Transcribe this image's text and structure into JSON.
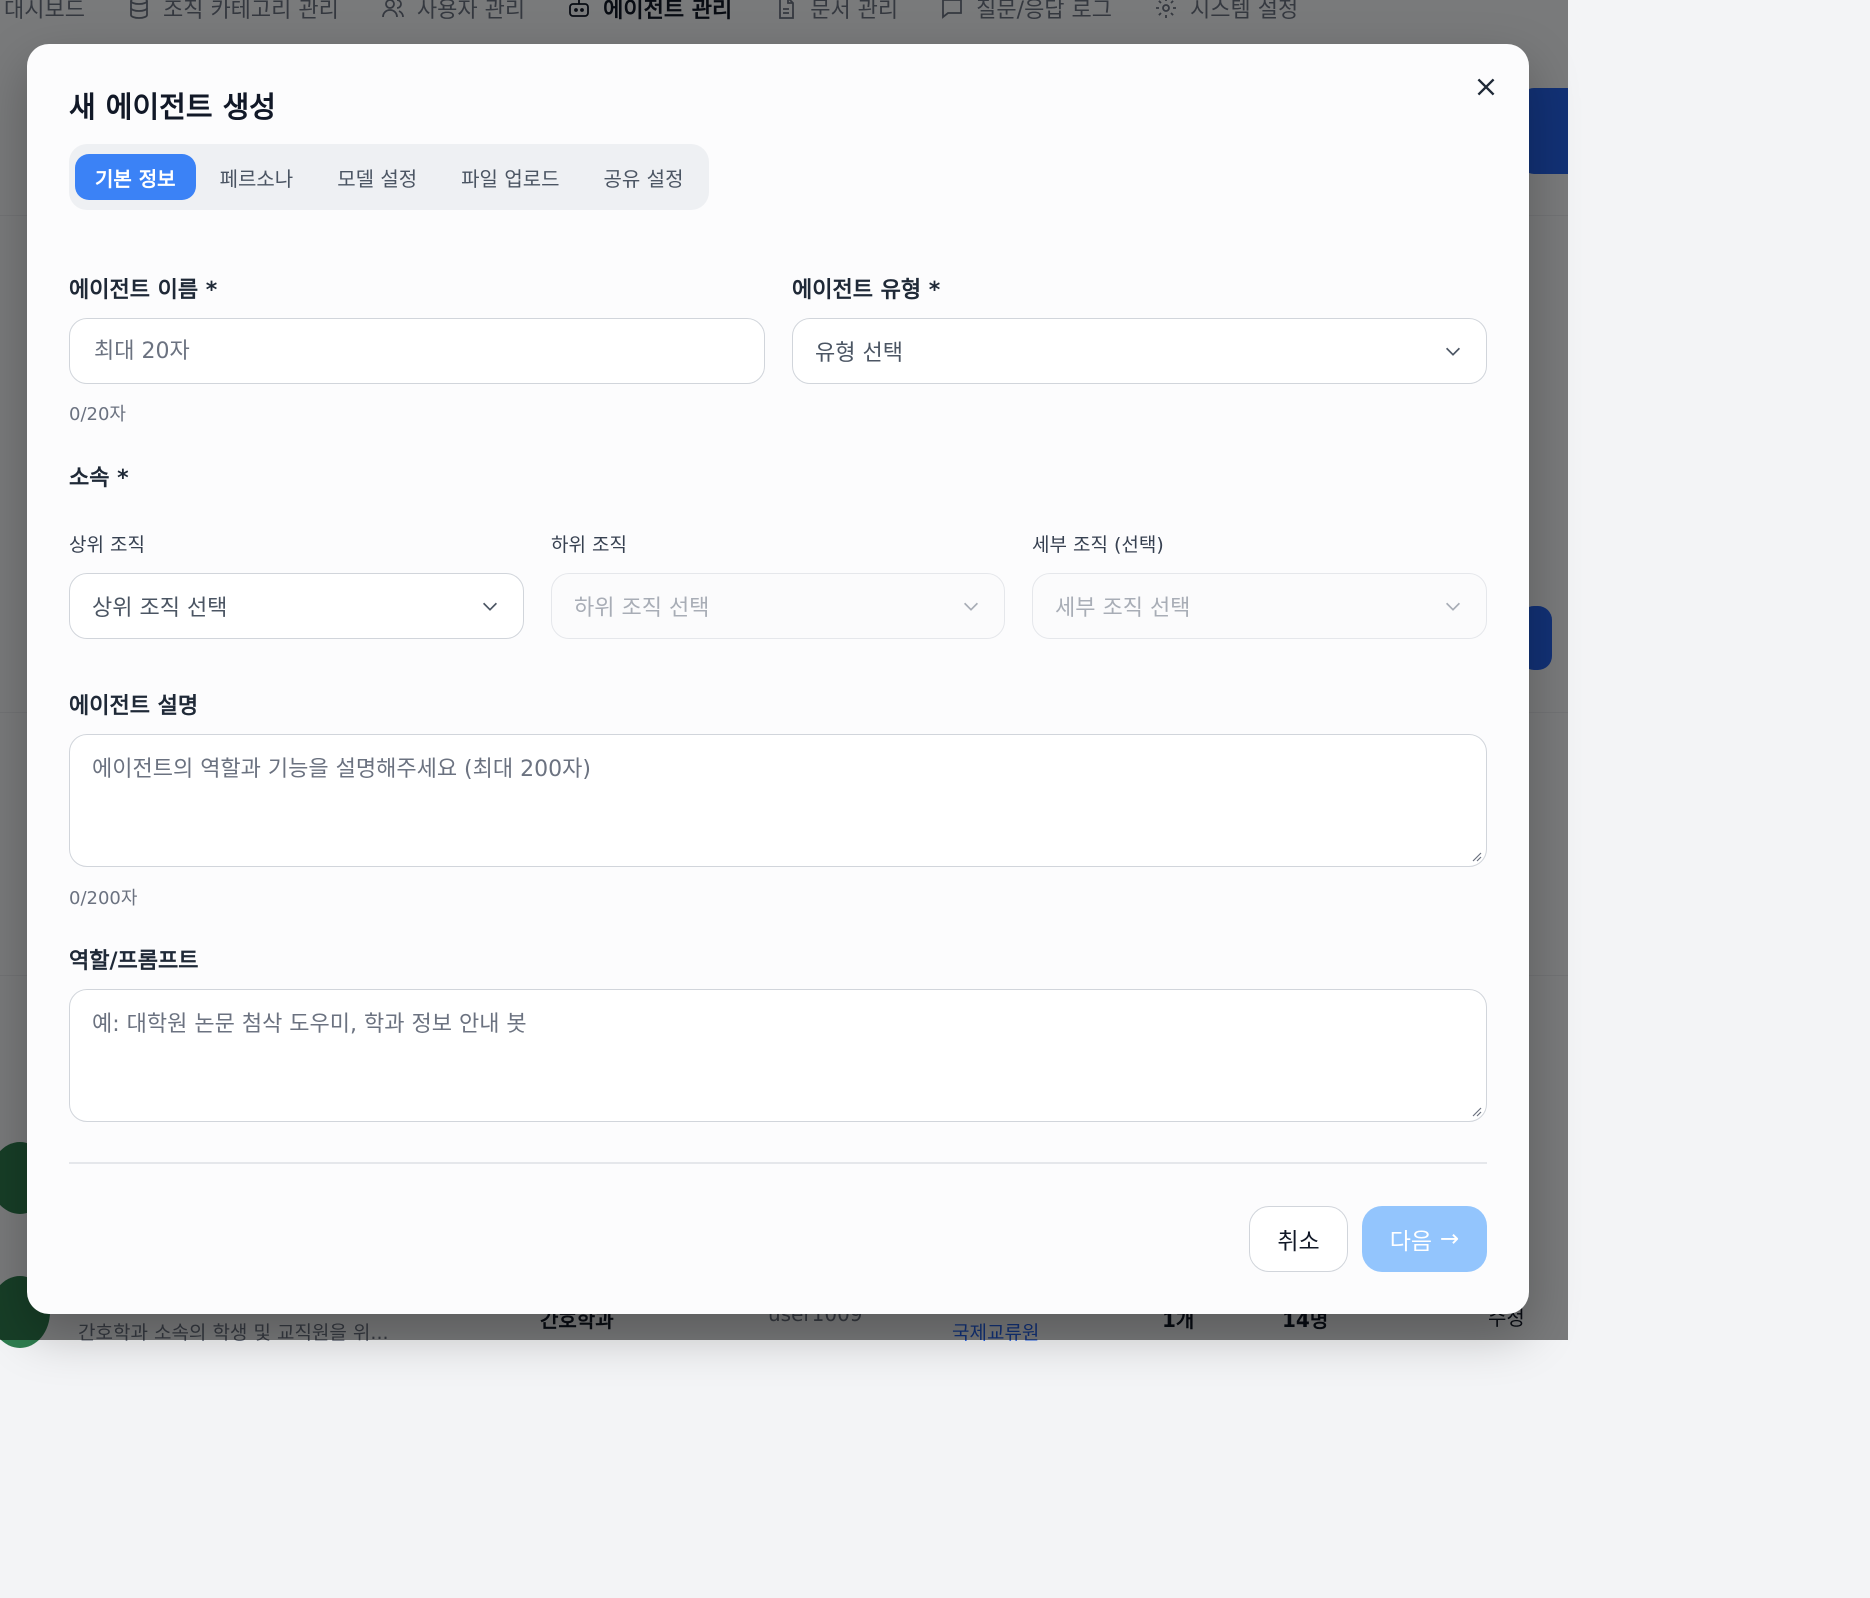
{
  "nav": {
    "items": [
      {
        "label": "대시보드",
        "icon": "none"
      },
      {
        "label": "조직 카테고리 관리",
        "icon": "database-icon"
      },
      {
        "label": "사용자 관리",
        "icon": "users-icon"
      },
      {
        "label": "에이전트 관리",
        "icon": "bot-icon",
        "active": true
      },
      {
        "label": "문서 관리",
        "icon": "document-icon"
      },
      {
        "label": "질문/응답 로그",
        "icon": "chat-icon"
      },
      {
        "label": "시스템 설정",
        "icon": "gear-icon"
      }
    ]
  },
  "background": {
    "row_description": "간호학과 소속의 학생 및 교직원을 위...",
    "row_org": "간호학과",
    "row_user": "user1009",
    "row_dept": "국제교류원",
    "row_count1": "1개",
    "row_count2": "14명",
    "row_edit": "수정"
  },
  "modal": {
    "title": "새 에이전트 생성",
    "tabs": [
      "기본 정보",
      "페르소나",
      "모델 설정",
      "파일 업로드",
      "공유 설정"
    ],
    "active_tab": 0,
    "name": {
      "label": "에이전트 이름 *",
      "placeholder": "최대 20자",
      "value": "",
      "counter": "0/20자"
    },
    "type": {
      "label": "에이전트 유형 *",
      "placeholder": "유형 선택"
    },
    "affiliation": {
      "label": "소속 *",
      "upper": {
        "label": "상위 조직",
        "placeholder": "상위 조직 선택"
      },
      "lower": {
        "label": "하위 조직",
        "placeholder": "하위 조직 선택"
      },
      "detail": {
        "label": "세부 조직 (선택)",
        "placeholder": "세부 조직 선택"
      }
    },
    "description": {
      "label": "에이전트 설명",
      "placeholder": "에이전트의 역할과 기능을 설명해주세요 (최대 200자)",
      "counter": "0/200자"
    },
    "prompt": {
      "label": "역할/프롬프트",
      "placeholder": "예: 대학원 논문 첨삭 도우미, 학과 정보 안내 봇"
    },
    "buttons": {
      "cancel": "취소",
      "next": "다음",
      "next_arrow": "→"
    }
  },
  "colors": {
    "accent": "#3b82f6",
    "next_disabled": "#93c5fd",
    "overlay": "rgba(0,0,0,0.5)"
  }
}
